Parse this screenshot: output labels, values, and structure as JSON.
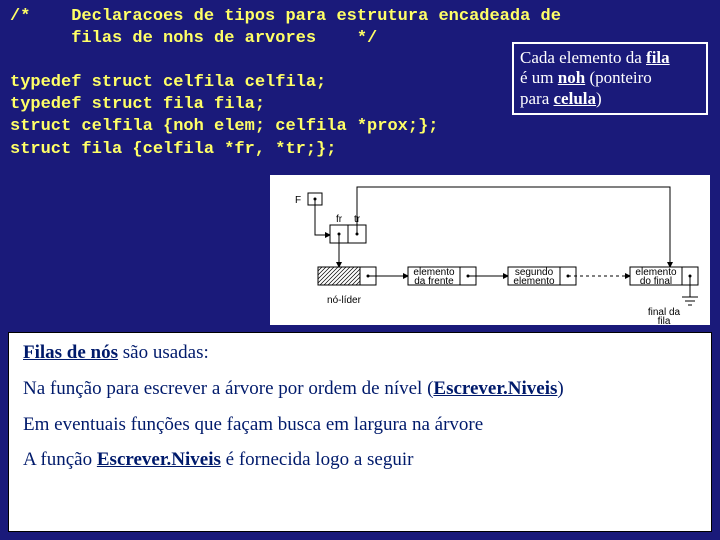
{
  "code": {
    "l1": "/*    Declaracoes de tipos para estrutura encadeada de",
    "l2": "      filas de nohs de arvores    */",
    "l3": "",
    "l4": "typedef struct celfila celfila;",
    "l5": "typedef struct fila fila;",
    "l6": "struct celfila {noh elem; celfila *prox;};",
    "l7": "struct fila {celfila *fr, *tr;};"
  },
  "callout": {
    "line1a": "Cada elemento da ",
    "line1b": "fila",
    "line2a": "é um ",
    "line2b": "noh",
    "line2c": " (ponteiro",
    "line3a": "para ",
    "line3b": "celula",
    "line3c": ")"
  },
  "diagram_labels": {
    "F": "F",
    "fr": "fr",
    "tr": "tr",
    "elem_frente": "elemento\nda frente",
    "segundo": "segundo\nelemento",
    "elem_final": "elemento\ndo final",
    "no_lider": "nó-líder",
    "final_fila": "final da\nfila"
  },
  "whitebox": {
    "p1a": "Filas de nós",
    "p1b": " são usadas:",
    "p2a": "Na função para escrever a árvore por ordem de nível (",
    "p2b": "Escrever.Niveis",
    "p2c": ")",
    "p3": "Em eventuais funções que façam busca em largura na árvore",
    "p4a": "A função ",
    "p4b": "Escrever.Niveis",
    "p4c": " é fornecida logo a seguir"
  }
}
